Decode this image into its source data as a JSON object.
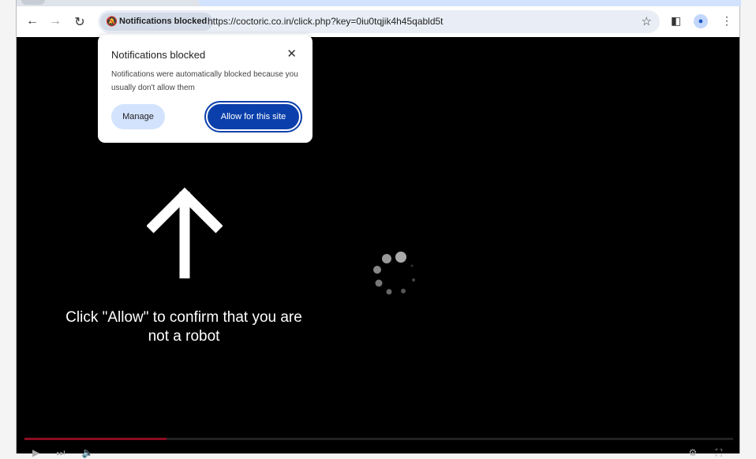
{
  "browser": {
    "chip_label": "Notifications blocked",
    "chip_icon": "bell-slash-icon",
    "url": "https://coctoric.co.in/click.php?key=0iu0tqjik4h45qabld5t"
  },
  "popup": {
    "title": "Notifications blocked",
    "body": "Notifications were automatically blocked because you usually don't allow them",
    "manage_label": "Manage",
    "allow_label": "Allow for this site"
  },
  "page": {
    "message": "Click \"Allow\" to confirm that you are not a robot"
  },
  "player": {
    "progress_percent": 20,
    "progress_color": "#8b0d22"
  },
  "colors": {
    "accent": "#0b3fab"
  }
}
